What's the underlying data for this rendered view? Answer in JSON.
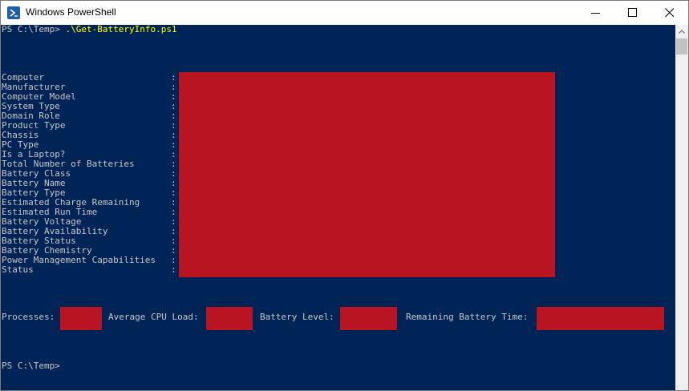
{
  "window": {
    "title": "Windows PowerShell"
  },
  "console": {
    "prompt1": "PS C:\\Temp> ",
    "command": ".\\Get-BatteryInfo.ps1",
    "fields": [
      "Computer",
      "Manufacturer",
      "Computer Model",
      "System Type",
      "Domain Role",
      "Product Type",
      "Chassis",
      "PC Type",
      "Is a Laptop?",
      "Total Number of Batteries",
      "Battery Class",
      "Battery Name",
      "Battery Type",
      "Estimated Charge Remaining",
      "Estimated Run Time",
      "Battery Voltage",
      "Battery Availability",
      "Battery Status",
      "Battery Chemistry",
      "Power Management Capabilities",
      "Status"
    ],
    "separator": ":",
    "stats": {
      "processes": "Processes:",
      "cpu": "Average CPU Load:",
      "battery_level": "Battery Level:",
      "remaining_time": "Remaining Battery Time:"
    },
    "prompt2": "PS C:\\Temp>"
  },
  "colors": {
    "console_bg": "#012456",
    "console_text": "#c8c8c8",
    "command_text": "#ffff00",
    "redaction": "#b91422"
  }
}
